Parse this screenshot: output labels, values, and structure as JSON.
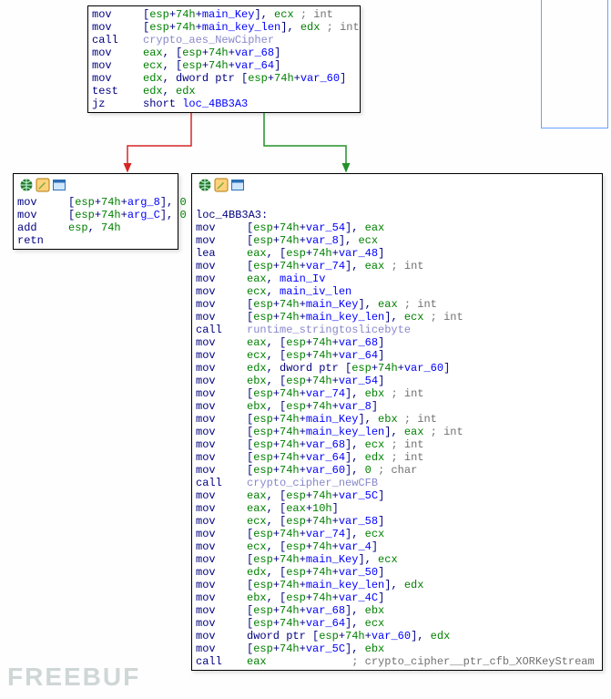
{
  "watermark": "FREEBUF",
  "nodes": {
    "top": {
      "lines": [
        {
          "mn": "mov",
          "op": "[<hx>esp</hx>+<hx>74h</hx>+<id>main_Key</id>], <hx>ecx</hx> <cmt>; int</cmt>"
        },
        {
          "mn": "mov",
          "op": "[<hx>esp</hx>+<hx>74h</hx>+<id>main_key_len</id>], <hx>edx</hx> <cmt>; int</cmt>"
        },
        {
          "mn": "call",
          "op": "<fn>crypto_aes_NewCipher</fn>"
        },
        {
          "mn": "mov",
          "op": "<hx>eax</hx>, [<hx>esp</hx>+<hx>74h</hx>+<id>var_68</id>]"
        },
        {
          "mn": "mov",
          "op": "<hx>ecx</hx>, [<hx>esp</hx>+<hx>74h</hx>+<id>var_64</id>]"
        },
        {
          "mn": "mov",
          "op": "<hx>edx</hx>, <pl>dword ptr</pl> [<hx>esp</hx>+<hx>74h</hx>+<id>var_60</id>]"
        },
        {
          "mn": "test",
          "op": "<hx>edx</hx>, <hx>edx</hx>"
        },
        {
          "mn": "jz",
          "op": "<pl>short</pl> <id>loc_4BB3A3</id>"
        }
      ]
    },
    "left": {
      "lines": [
        {
          "mn": "mov",
          "op": "[<hx>esp</hx>+<hx>74h</hx>+<id>arg_8</id>], <hx>0</hx>"
        },
        {
          "mn": "mov",
          "op": "[<hx>esp</hx>+<hx>74h</hx>+<id>arg_C</id>], <hx>0</hx>"
        },
        {
          "mn": "add",
          "op": "<hx>esp</hx>, <hx>74h</hx>"
        },
        {
          "mn": "retn",
          "op": ""
        }
      ]
    },
    "right": {
      "label": "loc_4BB3A3:",
      "lines": [
        {
          "mn": "mov",
          "op": "[<hx>esp</hx>+<hx>74h</hx>+<id>var_54</id>], <hx>eax</hx>"
        },
        {
          "mn": "mov",
          "op": "[<hx>esp</hx>+<hx>74h</hx>+<id>var_8</id>], <hx>ecx</hx>"
        },
        {
          "mn": "lea",
          "op": "<hx>eax</hx>, [<hx>esp</hx>+<hx>74h</hx>+<id>var_48</id>]"
        },
        {
          "mn": "mov",
          "op": "[<hx>esp</hx>+<hx>74h</hx>+<id>var_74</id>], <hx>eax</hx> <cmt>; int</cmt>"
        },
        {
          "mn": "mov",
          "op": "<hx>eax</hx>, <id>main_Iv</id>"
        },
        {
          "mn": "mov",
          "op": "<hx>ecx</hx>, <id>main_iv_len</id>"
        },
        {
          "mn": "mov",
          "op": "[<hx>esp</hx>+<hx>74h</hx>+<id>main_Key</id>], <hx>eax</hx> <cmt>; int</cmt>"
        },
        {
          "mn": "mov",
          "op": "[<hx>esp</hx>+<hx>74h</hx>+<id>main_key_len</id>], <hx>ecx</hx> <cmt>; int</cmt>"
        },
        {
          "mn": "call",
          "op": "<fn>runtime_stringtoslicebyte</fn>"
        },
        {
          "mn": "mov",
          "op": "<hx>eax</hx>, [<hx>esp</hx>+<hx>74h</hx>+<id>var_68</id>]"
        },
        {
          "mn": "mov",
          "op": "<hx>ecx</hx>, [<hx>esp</hx>+<hx>74h</hx>+<id>var_64</id>]"
        },
        {
          "mn": "mov",
          "op": "<hx>edx</hx>, <pl>dword ptr</pl> [<hx>esp</hx>+<hx>74h</hx>+<id>var_60</id>]"
        },
        {
          "mn": "mov",
          "op": "<hx>ebx</hx>, [<hx>esp</hx>+<hx>74h</hx>+<id>var_54</id>]"
        },
        {
          "mn": "mov",
          "op": "[<hx>esp</hx>+<hx>74h</hx>+<id>var_74</id>], <hx>ebx</hx> <cmt>; int</cmt>"
        },
        {
          "mn": "mov",
          "op": "<hx>ebx</hx>, [<hx>esp</hx>+<hx>74h</hx>+<id>var_8</id>]"
        },
        {
          "mn": "mov",
          "op": "[<hx>esp</hx>+<hx>74h</hx>+<id>main_Key</id>], <hx>ebx</hx> <cmt>; int</cmt>"
        },
        {
          "mn": "mov",
          "op": "[<hx>esp</hx>+<hx>74h</hx>+<id>main_key_len</id>], <hx>eax</hx> <cmt>; int</cmt>"
        },
        {
          "mn": "mov",
          "op": "[<hx>esp</hx>+<hx>74h</hx>+<id>var_68</id>], <hx>ecx</hx> <cmt>; int</cmt>"
        },
        {
          "mn": "mov",
          "op": "[<hx>esp</hx>+<hx>74h</hx>+<id>var_64</id>], <hx>edx</hx> <cmt>; int</cmt>"
        },
        {
          "mn": "mov",
          "op": "[<hx>esp</hx>+<hx>74h</hx>+<id>var_60</id>], <hx>0</hx> <cmt>; char</cmt>"
        },
        {
          "mn": "call",
          "op": "<fn>crypto_cipher_newCFB</fn>"
        },
        {
          "mn": "mov",
          "op": "<hx>eax</hx>, [<hx>esp</hx>+<hx>74h</hx>+<id>var_5C</id>]"
        },
        {
          "mn": "mov",
          "op": "<hx>eax</hx>, [<hx>eax</hx>+<hx>10h</hx>]"
        },
        {
          "mn": "mov",
          "op": "<hx>ecx</hx>, [<hx>esp</hx>+<hx>74h</hx>+<id>var_58</id>]"
        },
        {
          "mn": "mov",
          "op": "[<hx>esp</hx>+<hx>74h</hx>+<id>var_74</id>], <hx>ecx</hx>"
        },
        {
          "mn": "mov",
          "op": "<hx>ecx</hx>, [<hx>esp</hx>+<hx>74h</hx>+<id>var_4</id>]"
        },
        {
          "mn": "mov",
          "op": "[<hx>esp</hx>+<hx>74h</hx>+<id>main_Key</id>], <hx>ecx</hx>"
        },
        {
          "mn": "mov",
          "op": "<hx>edx</hx>, [<hx>esp</hx>+<hx>74h</hx>+<id>var_50</id>]"
        },
        {
          "mn": "mov",
          "op": "[<hx>esp</hx>+<hx>74h</hx>+<id>main_key_len</id>], <hx>edx</hx>"
        },
        {
          "mn": "mov",
          "op": "<hx>ebx</hx>, [<hx>esp</hx>+<hx>74h</hx>+<id>var_4C</id>]"
        },
        {
          "mn": "mov",
          "op": "[<hx>esp</hx>+<hx>74h</hx>+<id>var_68</id>], <hx>ebx</hx>"
        },
        {
          "mn": "mov",
          "op": "[<hx>esp</hx>+<hx>74h</hx>+<id>var_64</id>], <hx>ecx</hx>"
        },
        {
          "mn": "mov",
          "op": "<pl>dword ptr</pl> [<hx>esp</hx>+<hx>74h</hx>+<id>var_60</id>], <hx>edx</hx>"
        },
        {
          "mn": "mov",
          "op": "[<hx>esp</hx>+<hx>74h</hx>+<id>var_5C</id>], <hx>ebx</hx>"
        },
        {
          "mn": "call",
          "op": "<hx>eax</hx>             <cmt>; crypto_cipher__ptr_cfb_XORKeyStream</cmt>"
        }
      ]
    }
  },
  "arrows": {
    "false_color": "#d52626",
    "true_color": "#229128"
  }
}
